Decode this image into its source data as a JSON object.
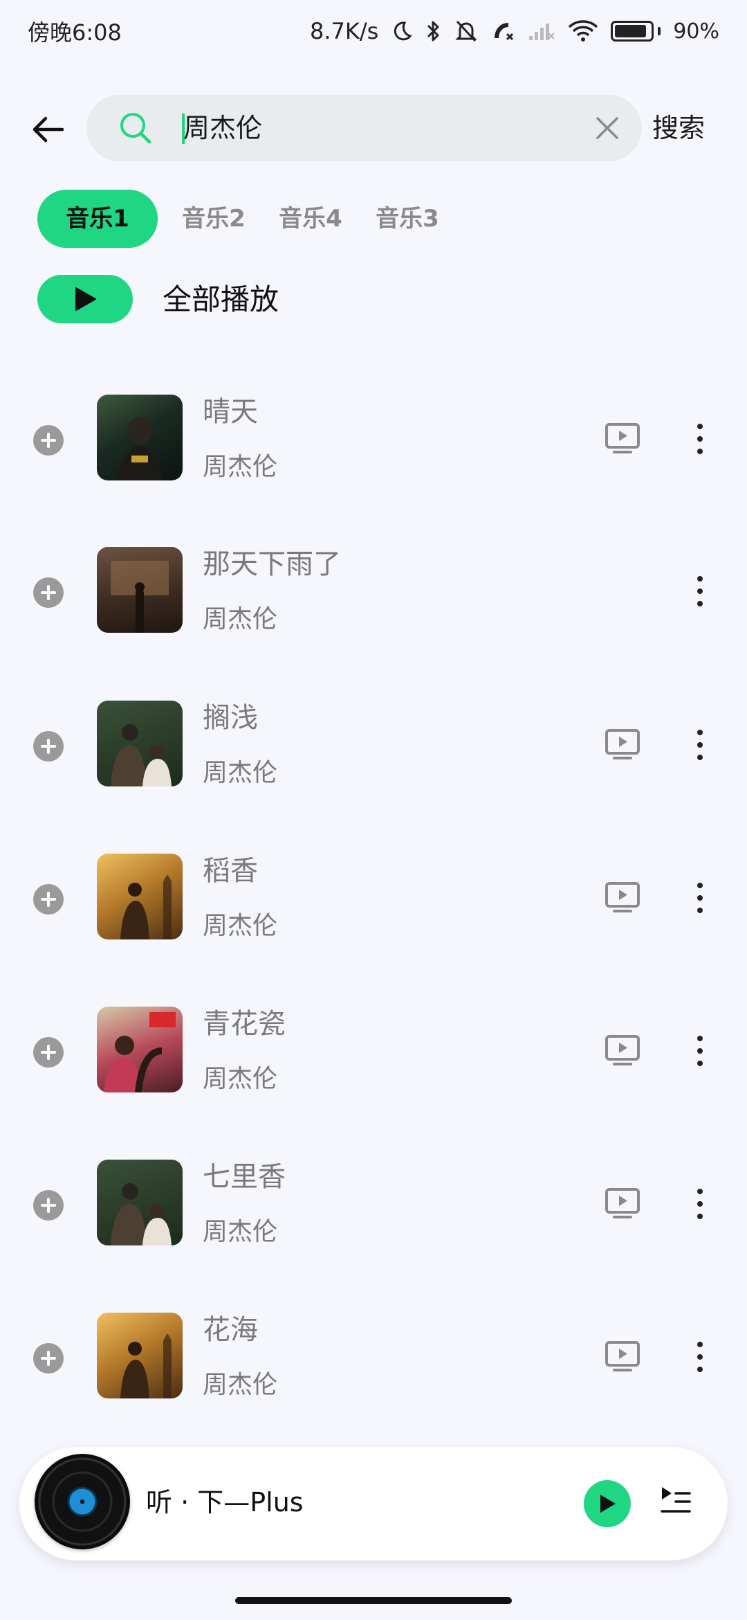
{
  "status_bar": {
    "time": "傍晚6:08",
    "network_speed": "8.7K/s",
    "battery_percent": "90%",
    "battery_level": 0.9,
    "icons": [
      "moon-icon",
      "bluetooth-icon",
      "mute-bell-icon",
      "call-icon",
      "signal-icon",
      "wifi-icon",
      "battery-icon"
    ]
  },
  "search": {
    "query": "周杰伦",
    "submit_label": "搜索"
  },
  "tabs": [
    {
      "label": "音乐1",
      "active": true
    },
    {
      "label": "音乐2",
      "active": false
    },
    {
      "label": "音乐4",
      "active": false
    },
    {
      "label": "音乐3",
      "active": false
    }
  ],
  "play_all": {
    "label": "全部播放"
  },
  "songs": [
    {
      "title": "晴天",
      "artist": "周杰伦",
      "has_mv": true
    },
    {
      "title": "那天下雨了",
      "artist": "周杰伦",
      "has_mv": false
    },
    {
      "title": "搁浅",
      "artist": "周杰伦",
      "has_mv": true
    },
    {
      "title": "稻香",
      "artist": "周杰伦",
      "has_mv": true
    },
    {
      "title": "青花瓷",
      "artist": "周杰伦",
      "has_mv": true
    },
    {
      "title": "七里香",
      "artist": "周杰伦",
      "has_mv": true
    },
    {
      "title": "花海",
      "artist": "周杰伦",
      "has_mv": true
    }
  ],
  "player": {
    "title": "听 · 下—Plus"
  },
  "colors": {
    "accent": "#1fd683",
    "background": "#f6f7fd",
    "search_bg": "#e8ecee",
    "muted_text": "#7a7a7a"
  }
}
